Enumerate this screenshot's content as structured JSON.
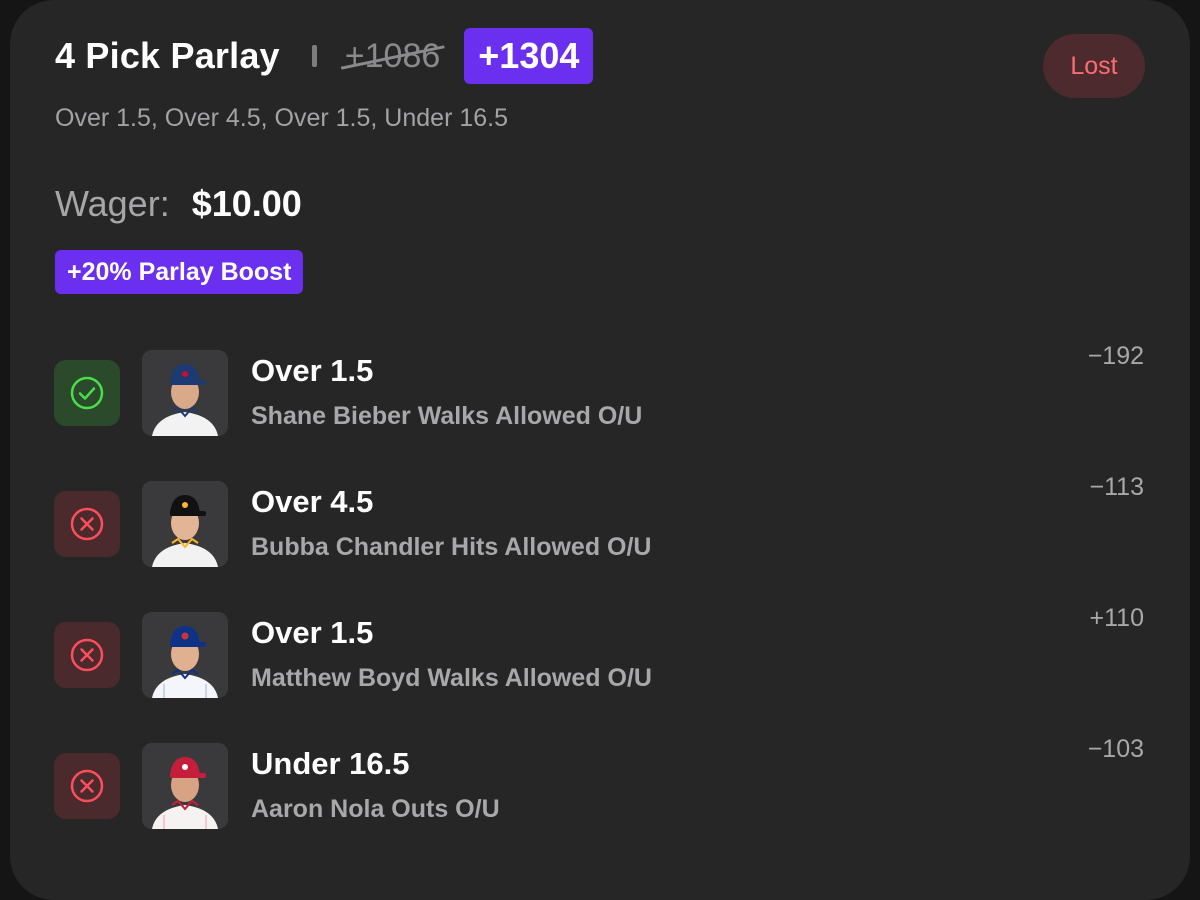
{
  "header": {
    "title": "4 Pick Parlay",
    "original_odds": "+1086",
    "boosted_odds": "+1304",
    "status": "Lost"
  },
  "subtitle": "Over 1.5, Over 4.5, Over 1.5, Under 16.5",
  "wager": {
    "label": "Wager:",
    "amount": "$10.00"
  },
  "boost_label": "+20% Parlay Boost",
  "colors": {
    "accent": "#6b2ff0",
    "won": "#4ade4a",
    "lost": "#ff4d5a",
    "card_bg": "#262627"
  },
  "picks": [
    {
      "line": "Over 1.5",
      "market": "Shane Bieber Walks Allowed O/U",
      "odds": "−192",
      "result": "won",
      "result_icon": "check-circle-icon",
      "cap_color": "#1d3b73",
      "logo_color": "#c8102e"
    },
    {
      "line": "Over 4.5",
      "market": "Bubba Chandler Hits Allowed O/U",
      "odds": "−113",
      "result": "lost",
      "result_icon": "x-circle-icon",
      "cap_color": "#111111",
      "logo_color": "#fdb827"
    },
    {
      "line": "Over 1.5",
      "market": "Matthew Boyd Walks Allowed O/U",
      "odds": "+110",
      "result": "lost",
      "result_icon": "x-circle-icon",
      "cap_color": "#0e3386",
      "logo_color": "#cc3433"
    },
    {
      "line": "Under 16.5",
      "market": "Aaron Nola Outs O/U",
      "odds": "−103",
      "result": "lost",
      "result_icon": "x-circle-icon",
      "cap_color": "#c41e3a",
      "logo_color": "#ffffff"
    }
  ]
}
